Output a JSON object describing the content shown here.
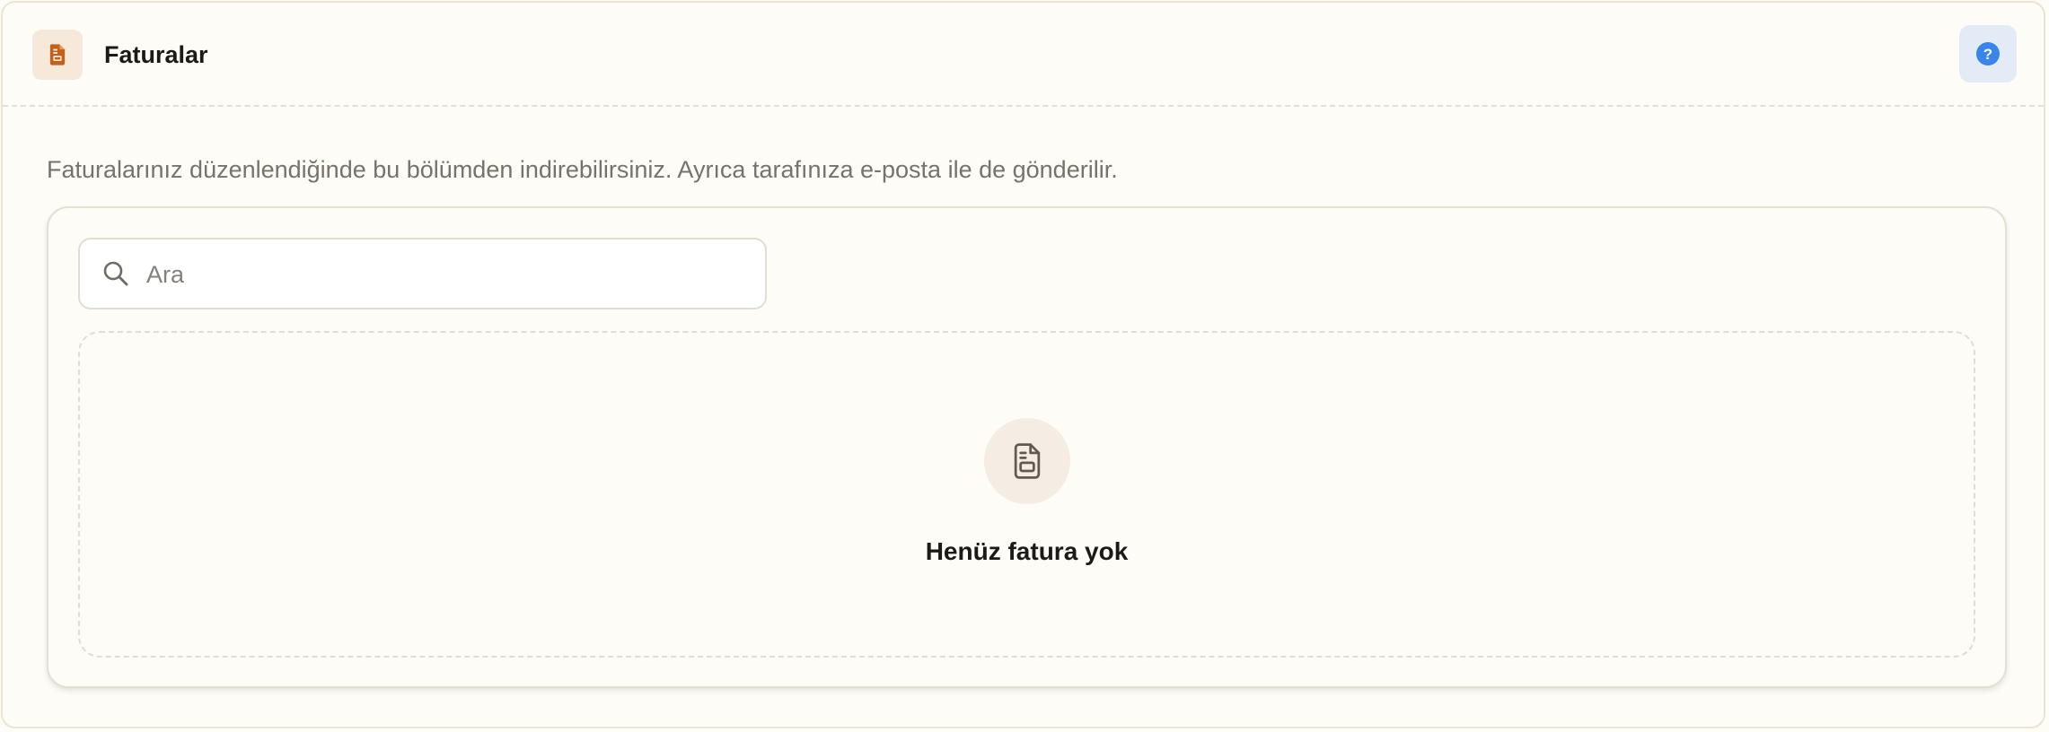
{
  "header": {
    "title": "Faturalar",
    "icon": "invoice-icon",
    "icon_color": "#c2611b",
    "help_icon": "question-icon",
    "help_color": "#3a85ea"
  },
  "description": "Faturalarınız düzenlendiğinde bu bölümden indirebilirsiniz. Ayrıca tarafınıza e-posta ile de gönderilir.",
  "search": {
    "placeholder": "Ara",
    "value": "",
    "icon": "search-icon"
  },
  "empty_state": {
    "icon": "invoice-icon",
    "message": "Henüz fatura yok"
  }
}
